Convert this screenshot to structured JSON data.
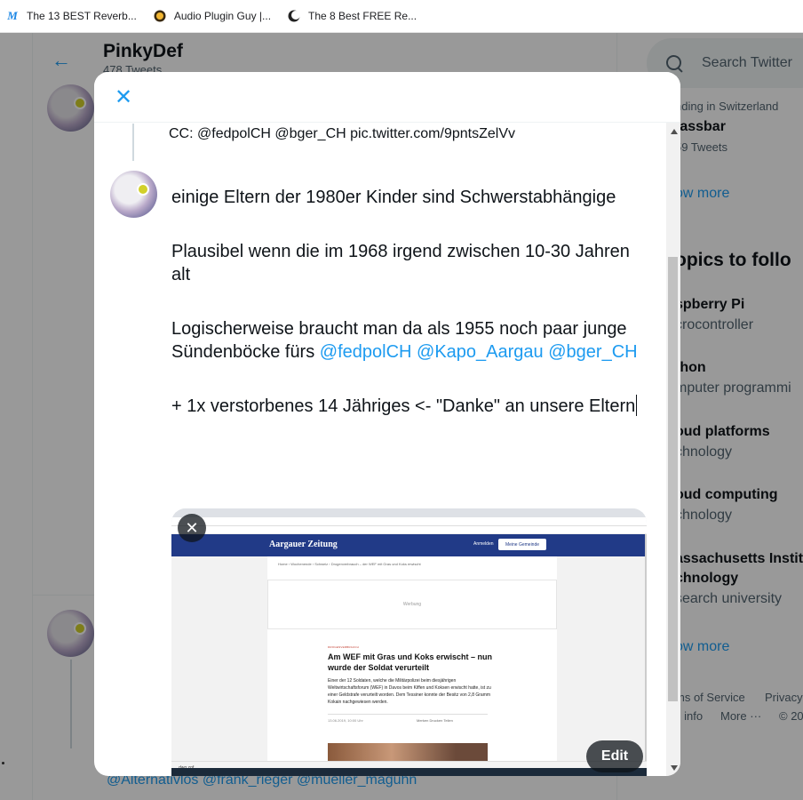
{
  "bookmarks": [
    {
      "icon": "m-logo-icon",
      "label": "The 13 BEST Reverb..."
    },
    {
      "icon": "guy-face-icon",
      "label": "Audio Plugin Guy |..."
    },
    {
      "icon": "moon-logo-icon",
      "label": "The 8 Best FREE Re..."
    }
  ],
  "profile": {
    "name": "PinkyDef",
    "tweet_count": "478 Tweets"
  },
  "background_tweet": {
    "mentions": "@Alternativlos @frank_rieger @mueller_maguhn"
  },
  "sidebar": {
    "search_placeholder": "Search Twitter",
    "trend_context": "nding in Switzerland",
    "trend_name": "fassbar",
    "trend_tweets": "59 Tweets",
    "show_more_1": "ow more",
    "topics_heading": "opics to follo",
    "topics": [
      {
        "name": "spberry Pi",
        "category": "crocontroller"
      },
      {
        "name": "thon",
        "category": "mputer programmi"
      },
      {
        "name": "oud platforms",
        "category": "chnology"
      },
      {
        "name": "oud computing",
        "category": "chnology"
      },
      {
        "name": "assachusetts Instit",
        "name2": "chnology",
        "category": "search university"
      }
    ],
    "show_more_2": "ow more",
    "footer_line1_a": "ms of Service",
    "footer_line1_b": "Privacy",
    "footer_line2_a": "s info",
    "footer_line2_b": "More",
    "footer_line2_c": "© 20"
  },
  "modal": {
    "quoted_prefix": "CC:",
    "quoted_mentions": "@fedpolCH @bger_CH",
    "quoted_link": "pic.twitter.com/9pntsZelVv",
    "paragraphs": {
      "p1": "einige Eltern der 1980er Kinder sind Schwerstabhängige",
      "p2": "Plausibel wenn die im 1968 irgend zwischen 10-30 Jahren alt",
      "p3_text": "Logischerweise braucht man da als 1955 noch paar junge Sündenböcke fürs ",
      "p3_mention1": "@fedpolCH",
      "p3_mention2": "@Kapo_Aargau",
      "p3_mention3": "@bger_CH",
      "p4": "+ 1x verstorbenes 14 Jähriges <- \"Danke\" an unsere Eltern"
    },
    "edit_label": "Edit"
  },
  "attachment": {
    "brand": "Aargauer Zeitung",
    "login": "Anmelden",
    "subscribe": "Meine Gemeinde",
    "crumbs": "Home  ›  Wochenende  ›  Schweiz  ›  Drogenverbrauch – der WEF mit Gras und Koks erwischt",
    "ad_label": "Werbung",
    "kicker": "DROGENVERBRAUCH",
    "headline": "Am WEF mit Gras und Koks erwischt – nun wurde der Soldat verurteilt",
    "lead": "Einer der 12 Soldaten, welche die Militärpolizei beim diesjährigen Weltwirtschaftsforum (WEF) in Davos beim Kiffen und Koksen erwischt hatte, ist zu einer Geldstrafe verurteilt worden. Dem Tessiner konnte der Besitz von 2,8 Gramm Kokain nachgewiesen werden.",
    "date": "13.06.2019, 10:00 Uhr",
    "actions": "Merken    Drucken    Teilen",
    "taskbar": "dwg.zgf"
  }
}
